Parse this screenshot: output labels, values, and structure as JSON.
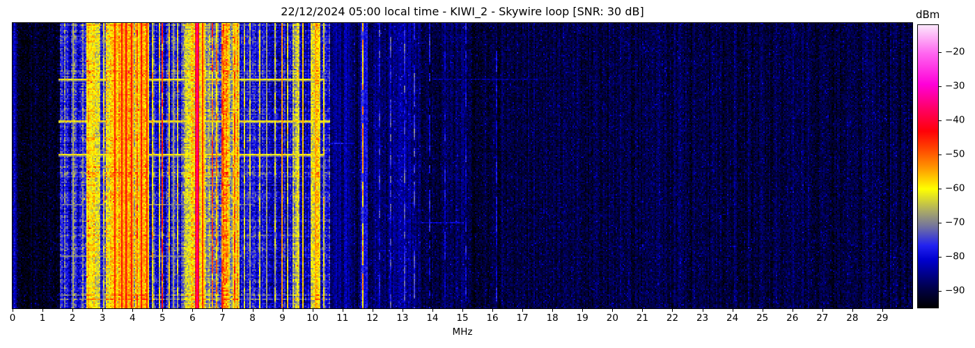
{
  "chart_data": {
    "type": "heatmap",
    "subtype": "hf-radio-spectrogram-waterfall",
    "title": "22/12/2024 05:00 local time - KIWI_2 - Skywire loop [SNR: 30 dB]",
    "xlabel": "MHz",
    "ylabel": "",
    "x_range": [
      0,
      30
    ],
    "x_ticks": [
      0,
      1,
      2,
      3,
      4,
      5,
      6,
      7,
      8,
      9,
      10,
      11,
      12,
      13,
      14,
      15,
      16,
      17,
      18,
      19,
      20,
      21,
      22,
      23,
      24,
      25,
      26,
      27,
      28,
      29
    ],
    "grid": false,
    "legend": false,
    "colorbar": {
      "label": "dBm",
      "position": "right",
      "range": [
        -95,
        -12
      ],
      "ticks": [
        -20,
        -30,
        -40,
        -50,
        -60,
        -70,
        -80,
        -90
      ],
      "stops": [
        {
          "u": 0.0,
          "color": "#000000"
        },
        {
          "u": 0.07,
          "color": "#00004a"
        },
        {
          "u": 0.17,
          "color": "#0000cf"
        },
        {
          "u": 0.22,
          "color": "#2222f0"
        },
        {
          "u": 0.285,
          "color": "#7070a0"
        },
        {
          "u": 0.34,
          "color": "#a8a868"
        },
        {
          "u": 0.42,
          "color": "#ffff00"
        },
        {
          "u": 0.5,
          "color": "#ff9000"
        },
        {
          "u": 0.57,
          "color": "#ff3c00"
        },
        {
          "u": 0.625,
          "color": "#ff0008"
        },
        {
          "u": 0.7,
          "color": "#ff0060"
        },
        {
          "u": 0.79,
          "color": "#ff00d8"
        },
        {
          "u": 0.9,
          "color": "#ff66f0"
        },
        {
          "u": 1.0,
          "color": "#fce8fc"
        }
      ]
    },
    "noise_floor_dbm": -92.5,
    "busy_rows_band_mhz": [
      1.45,
      10.6
    ],
    "bands": [
      [
        0.0,
        0.12,
        -84,
        5
      ],
      [
        0.12,
        1.55,
        -92.5,
        2.5
      ],
      [
        1.55,
        2.3,
        -80,
        9
      ],
      [
        2.3,
        2.44,
        -73,
        8
      ],
      [
        2.44,
        2.64,
        -58,
        5
      ],
      [
        2.64,
        2.88,
        -62,
        7
      ],
      [
        2.88,
        3.1,
        -76,
        8
      ],
      [
        3.1,
        3.5,
        -61,
        9
      ],
      [
        3.5,
        4.5,
        -60,
        10
      ],
      [
        4.5,
        5.6,
        -78,
        8
      ],
      [
        5.6,
        5.74,
        -71,
        8
      ],
      [
        5.74,
        6.02,
        -60,
        6
      ],
      [
        6.02,
        6.42,
        -68,
        10
      ],
      [
        6.42,
        7.0,
        -73,
        11
      ],
      [
        7.0,
        7.22,
        -55,
        7
      ],
      [
        7.22,
        7.3,
        -71,
        8
      ],
      [
        7.3,
        7.56,
        -60,
        7
      ],
      [
        7.56,
        8.6,
        -80,
        6
      ],
      [
        8.6,
        9.3,
        -81,
        6
      ],
      [
        9.3,
        9.55,
        -64,
        7
      ],
      [
        9.55,
        9.9,
        -79,
        7
      ],
      [
        9.9,
        10.22,
        -62,
        7
      ],
      [
        10.22,
        10.55,
        -80,
        6
      ],
      [
        10.55,
        11.3,
        -85,
        5
      ],
      [
        11.3,
        11.58,
        -88,
        4
      ],
      [
        11.58,
        11.82,
        -80,
        5
      ],
      [
        11.82,
        12.0,
        -88,
        4
      ],
      [
        12.0,
        13.6,
        -86.5,
        4.5
      ],
      [
        13.6,
        15.3,
        -89.5,
        3.5
      ],
      [
        15.3,
        16.3,
        -91,
        3
      ],
      [
        16.3,
        30.01,
        -90,
        3.2
      ]
    ],
    "vertical_lines": [
      [
        2.02,
        -67,
        1,
        0
      ],
      [
        3.02,
        -63,
        1,
        1
      ],
      [
        3.38,
        -46,
        1,
        0
      ],
      [
        3.62,
        -45,
        1,
        0
      ],
      [
        3.74,
        -44,
        1,
        0
      ],
      [
        3.96,
        -45,
        1,
        0
      ],
      [
        4.13,
        -51,
        1,
        1
      ],
      [
        4.27,
        -45,
        1,
        0
      ],
      [
        4.44,
        -47,
        1,
        0
      ],
      [
        4.63,
        -60,
        1,
        1
      ],
      [
        4.86,
        -62,
        1,
        1
      ],
      [
        4.97,
        -50,
        1,
        1
      ],
      [
        5.2,
        -60,
        1,
        1
      ],
      [
        5.32,
        -68,
        1,
        0
      ],
      [
        5.47,
        -62,
        1,
        1
      ],
      [
        6.15,
        -34,
        1,
        0
      ],
      [
        6.32,
        -47,
        1,
        0
      ],
      [
        6.62,
        -52,
        1,
        1
      ],
      [
        6.8,
        -56,
        1,
        1
      ],
      [
        6.95,
        -50,
        1,
        1
      ],
      [
        7.38,
        -50,
        1,
        1
      ],
      [
        7.48,
        -57,
        1,
        0
      ],
      [
        7.7,
        -64,
        1,
        1
      ],
      [
        7.9,
        -66,
        1,
        1
      ],
      [
        8.2,
        -64,
        1,
        1
      ],
      [
        8.47,
        -68,
        1,
        0
      ],
      [
        8.72,
        -66,
        1,
        1
      ],
      [
        8.95,
        -54,
        1,
        0
      ],
      [
        9.15,
        -62,
        1,
        1
      ],
      [
        9.68,
        -57,
        1,
        0
      ],
      [
        10.08,
        -55,
        1,
        0
      ],
      [
        10.35,
        -63,
        1,
        1
      ],
      [
        11.67,
        -56,
        1,
        2
      ],
      [
        12.2,
        -80,
        1,
        1
      ],
      [
        12.6,
        -79,
        1,
        1
      ],
      [
        13.05,
        -78,
        1,
        1
      ],
      [
        13.37,
        -76,
        1,
        2
      ],
      [
        13.9,
        -80,
        1,
        2
      ],
      [
        14.4,
        -84,
        1,
        1
      ],
      [
        15.1,
        -83,
        1,
        1
      ],
      [
        16.1,
        -84,
        1,
        1
      ]
    ],
    "impulse_rows": [
      [
        40,
        1.5,
        10.35,
        -60
      ],
      [
        40,
        14.0,
        17.5,
        -85
      ],
      [
        70,
        1.5,
        10.55,
        -59
      ],
      [
        94,
        1.5,
        10.4,
        -60
      ],
      [
        130,
        1.6,
        8.0,
        -71
      ],
      [
        167,
        1.6,
        7.6,
        -70
      ],
      [
        86,
        10.3,
        11.35,
        -79
      ],
      [
        143,
        13.6,
        15.0,
        -82
      ]
    ]
  }
}
